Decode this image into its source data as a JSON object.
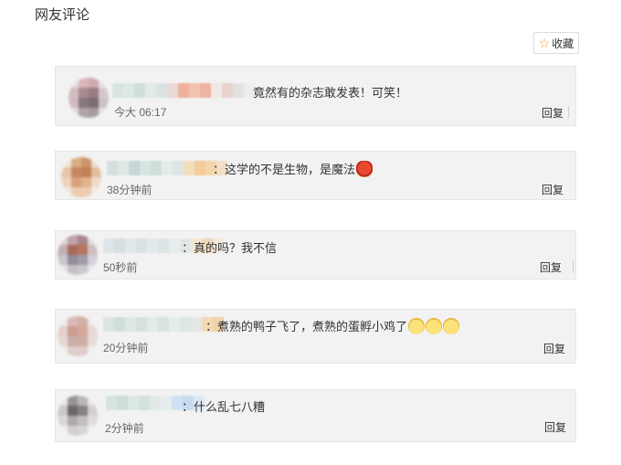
{
  "page": {
    "title": "网友评论"
  },
  "favorite": {
    "label": "收藏",
    "icon": "star-outline-icon",
    "icon_color": "#f0a020"
  },
  "comments": [
    {
      "text": "竟然有的杂志敢发表！可笑！",
      "time": "今大 06:17",
      "reply": "回复",
      "emojis": []
    },
    {
      "text": "：这学的不是生物，是魔法",
      "time": "38分钟前",
      "reply": "回复",
      "emojis": [
        "red-lantern-emoji"
      ]
    },
    {
      "text": "：真的吗？我不信",
      "time": "50秒前",
      "reply": "回复",
      "emojis": []
    },
    {
      "text": "：煮熟的鸭子飞了，煮熟的蛋孵小鸡了",
      "time": "20分钟前",
      "reply": "回复",
      "emojis": [
        "cat-face-emoji",
        "cat-face-emoji",
        "cat-face-emoji"
      ]
    },
    {
      "text": "：什么乱七八糟",
      "time": "2分钟前",
      "reply": "回复",
      "emojis": []
    }
  ],
  "colors": {
    "comment_bg": "#f2f2f2",
    "accent_star": "#f0a020"
  }
}
